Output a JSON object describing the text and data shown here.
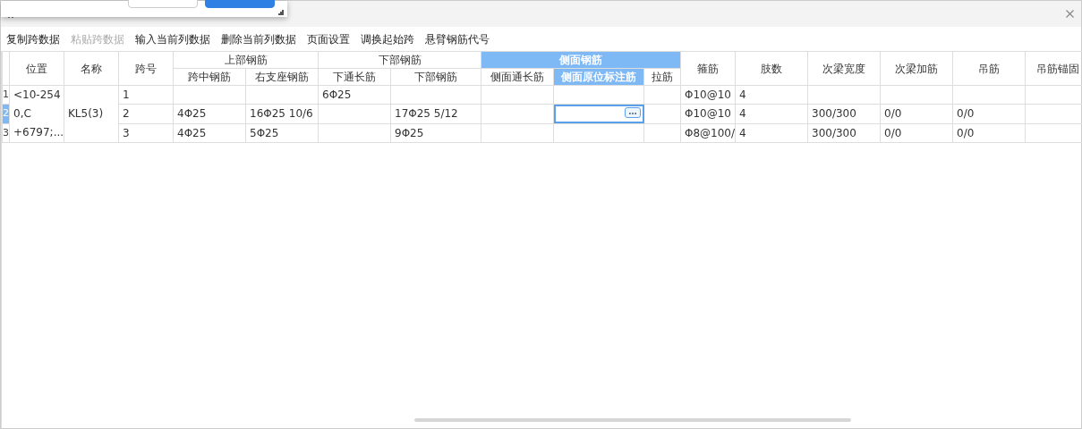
{
  "popup": {
    "buttons": [
      {
        "kind": "secondary"
      },
      {
        "kind": "primary"
      }
    ]
  },
  "toolbar": [
    {
      "label": "复制跨数据",
      "disabled": false
    },
    {
      "label": "粘贴跨数据",
      "disabled": true
    },
    {
      "label": "输入当前列数据",
      "disabled": false
    },
    {
      "label": "删除当前列数据",
      "disabled": false
    },
    {
      "label": "页面设置",
      "disabled": false
    },
    {
      "label": "调换起始跨",
      "disabled": false
    },
    {
      "label": "悬臂钢筋代号",
      "disabled": false
    }
  ],
  "table": {
    "columns": [
      {
        "label": "位置",
        "selected": false
      },
      {
        "label": "名称",
        "selected": false
      },
      {
        "label": "跨号",
        "selected": false
      },
      {
        "label": "上部钢筋",
        "selected": false,
        "colspan": 2,
        "children": [
          {
            "label": "跨中钢筋",
            "selected": false
          },
          {
            "label": "右支座钢筋",
            "selected": false
          }
        ]
      },
      {
        "label": "下部钢筋",
        "selected": false,
        "colspan": 2,
        "children": [
          {
            "label": "下通长筋",
            "selected": false
          },
          {
            "label": "下部钢筋",
            "selected": false
          }
        ]
      },
      {
        "label": "侧面钢筋",
        "selected": true,
        "colspan": 3,
        "children": [
          {
            "label": "侧面通长筋",
            "selected": false
          },
          {
            "label": "侧面原位标注筋",
            "selected": true
          },
          {
            "label": "拉筋",
            "selected": false
          }
        ]
      },
      {
        "label": "箍筋",
        "selected": false
      },
      {
        "label": "肢数",
        "selected": false
      },
      {
        "label": "次梁宽度",
        "selected": false
      },
      {
        "label": "次梁加筋",
        "selected": false
      },
      {
        "label": "吊筋",
        "selected": false
      },
      {
        "label": "吊筋锚固",
        "selected": false
      }
    ],
    "rows": [
      {
        "number": "1",
        "selected": false,
        "editing": false,
        "cells": [
          {
            "text": "<10-254\n0,C\n+6797;...",
            "rowspan": 3
          },
          {
            "text": "KL5(3)",
            "rowspan": 3
          },
          "1",
          "",
          "",
          "6Φ25",
          "",
          "",
          "",
          "",
          "Φ10@10",
          "4",
          "",
          "",
          "",
          ""
        ]
      },
      {
        "number": "2",
        "selected": true,
        "editing": true,
        "cells": [
          "2",
          "4Φ25",
          "16Φ25 10/6",
          "",
          "17Φ25 5/12",
          "",
          "",
          "",
          "Φ10@10",
          "4",
          "300/300",
          "0/0",
          "0/0",
          ""
        ]
      },
      {
        "number": "3",
        "selected": false,
        "editing": false,
        "cells": [
          "3",
          "4Φ25",
          "5Φ25",
          "",
          "9Φ25",
          "",
          "",
          "",
          "Φ8@100/",
          "4",
          "300/300",
          "0/0",
          "0/0",
          ""
        ]
      }
    ]
  }
}
